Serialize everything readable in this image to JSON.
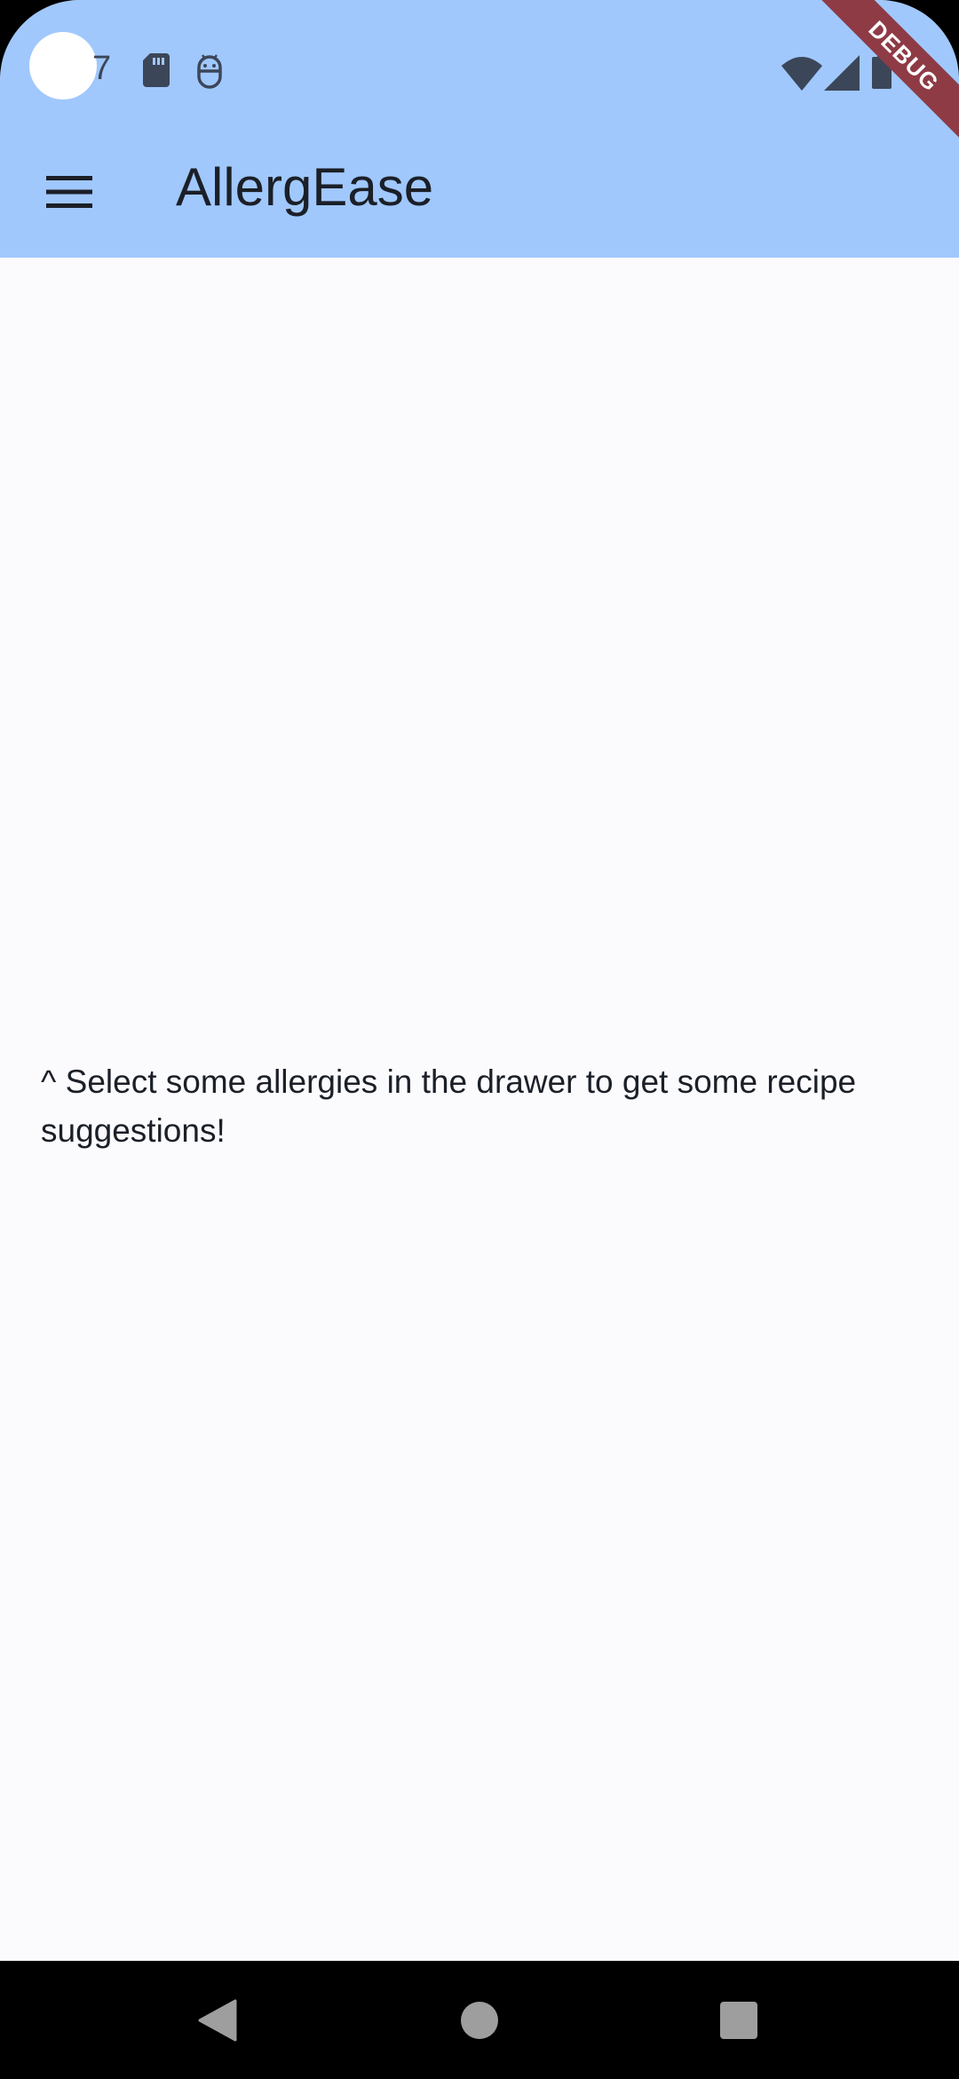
{
  "status_bar": {
    "time_fragment": "7",
    "icons": [
      "sd-card-icon",
      "android-debug-icon",
      "wifi-icon",
      "cell-signal-icon",
      "battery-icon"
    ],
    "icon_color": "#3c4659"
  },
  "debug_banner": {
    "label": "DEBUG",
    "color": "#8e3b46"
  },
  "app_bar": {
    "title": "AllergEase",
    "menu_icon": "menu-icon",
    "background": "#a0c8fd"
  },
  "main": {
    "hint": "^ Select some allergies in the drawer to get some recipe suggestions!",
    "background": "#fbfbfe"
  },
  "nav_bar": {
    "buttons": [
      "back-icon",
      "home-icon",
      "recents-icon"
    ],
    "background": "#000000"
  }
}
